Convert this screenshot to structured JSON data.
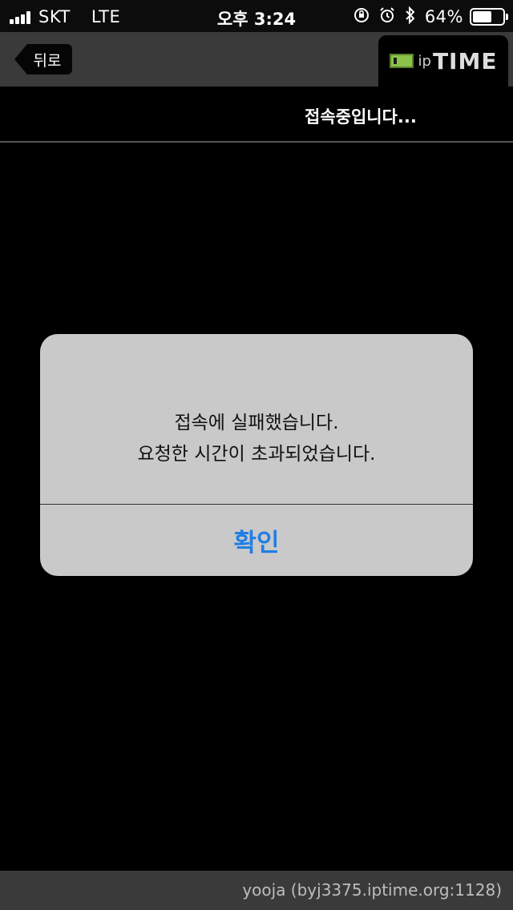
{
  "status_bar": {
    "carrier": "SKT",
    "network": "LTE",
    "time": "오후 3:24",
    "battery": "64%",
    "battery_level": 0.64,
    "icons": [
      "signal-icon",
      "orientation-lock-icon",
      "alarm-icon",
      "bluetooth-icon",
      "battery-icon"
    ]
  },
  "nav": {
    "back_label": "뒤로",
    "logo_ip": "ip",
    "logo_time": "TIME"
  },
  "connection": {
    "status_text": "접속중입니다..."
  },
  "dialog": {
    "line1": "접속에 실패했습니다.",
    "line2": "요청한 시간이 초과되었습니다.",
    "confirm_label": "확인"
  },
  "footer": {
    "text": "yooja (byj3375.iptime.org:1128)"
  },
  "colors": {
    "background": "#000000",
    "navbar": "#3a3a3a",
    "dialog": "#c9c9c9",
    "accent_button": "#1f7ee6",
    "logo_green": "#8bc34a"
  }
}
